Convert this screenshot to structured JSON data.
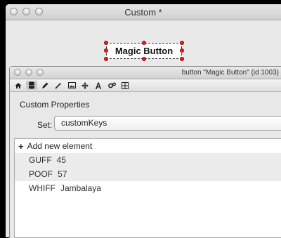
{
  "main_window": {
    "title": "Custom *",
    "button_label": "Magic Button"
  },
  "inspector": {
    "title": "button \"Magic Button\" (id 1003)",
    "toolbar_icons": [
      "home-icon",
      "database-icon",
      "pencil-icon",
      "magic-wand-icon",
      "image-icon",
      "move-icon",
      "text-icon",
      "gears-icon",
      "grid-icon"
    ],
    "section_title": "Custom Properties",
    "set_label": "Set:",
    "set_value": "customKeys",
    "add_label": "Add new element",
    "properties": [
      {
        "key": "GUFF",
        "value": "45"
      },
      {
        "key": "POOF",
        "value": "57"
      },
      {
        "key": "WHIFF",
        "value": "Jambalaya"
      }
    ]
  },
  "colors": {
    "background": "#000000",
    "window": "#e9e9e9",
    "handle": "#e02020"
  }
}
